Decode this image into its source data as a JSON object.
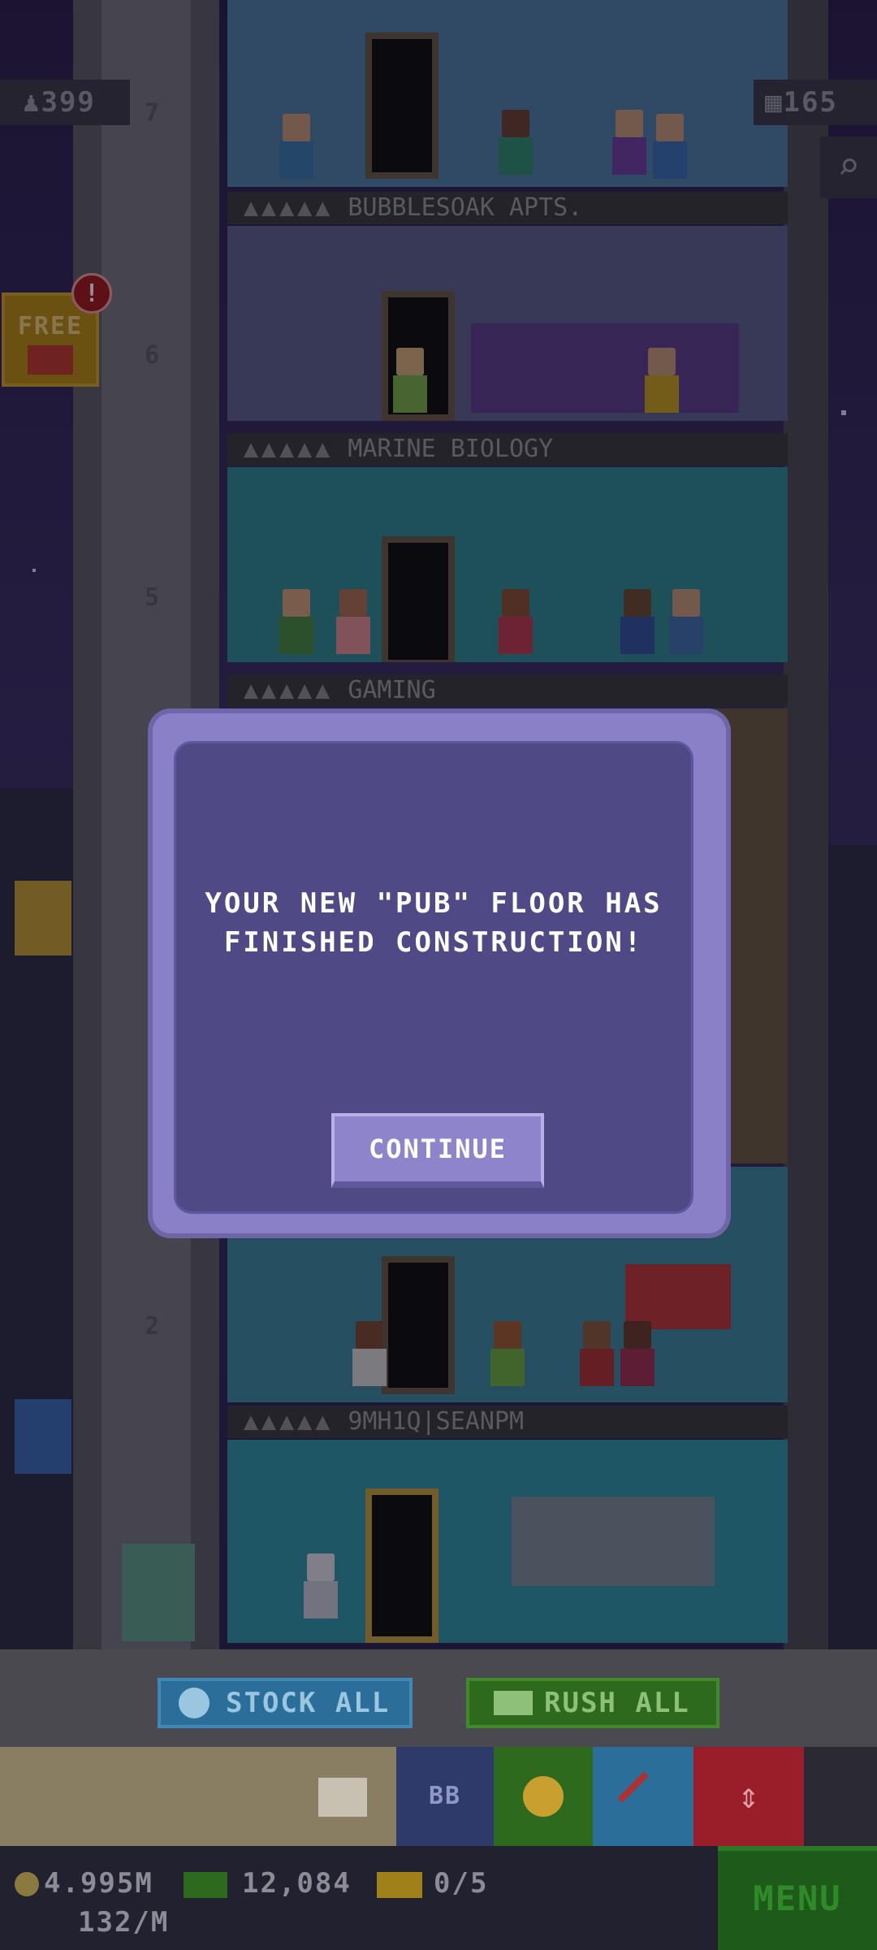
{
  "hud": {
    "population": "399",
    "bux": "165",
    "free_label": "FREE",
    "free_alert": "!"
  },
  "floors": {
    "labels": [
      "BUBBLESOAK APTS.",
      "MARINE BIOLOGY",
      "GAMING",
      "9MH1Q|SEANPM"
    ],
    "numbers": [
      "7",
      "6",
      "5",
      "2"
    ]
  },
  "modal": {
    "message_line1": "YOUR NEW \"PUB\" FLOOR HAS",
    "message_line2": "FINISHED CONSTRUCTION!",
    "continue_label": "CONTINUE"
  },
  "actions": {
    "stock_all_label": "STOCK ALL",
    "rush_all_label": "RUSH ALL"
  },
  "toolbar": {
    "bb_label": "BB"
  },
  "status": {
    "coins": "4.995M",
    "coins_rate": "132/M",
    "bux_count": "12,084",
    "tickets": "0/5",
    "menu_label": "MENU"
  },
  "colors": {
    "modal_accent": "#8a80c8",
    "modal_fill": "#4f4a86",
    "stock_button": "#2c6e9a",
    "rush_button": "#2e6a1e",
    "menu_button": "#1e5a1a"
  }
}
